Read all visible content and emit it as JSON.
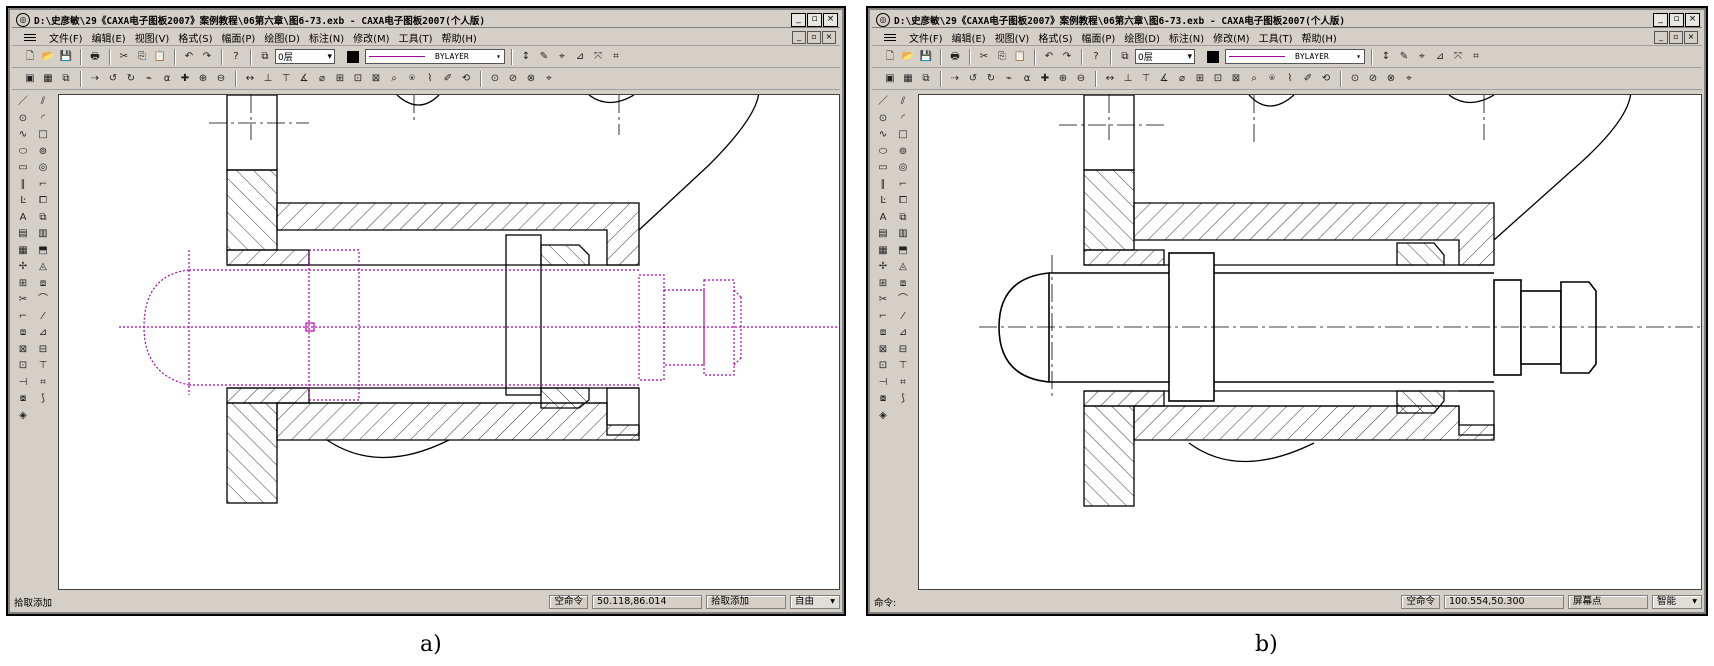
{
  "captions": {
    "a": "a)",
    "b": "b)"
  },
  "colors": {
    "preview_line": "#b000b0",
    "drawing_line": "#000000",
    "window_face": "#d4d0c8"
  },
  "window_a": {
    "title": "D:\\史彦敏\\29《CAXA电子图板2007》案例教程\\06第六章\\图6-73.exb - CAXA电子图板2007(个人版)",
    "menu": [
      "文件(F)",
      "编辑(E)",
      "视图(V)",
      "格式(S)",
      "幅面(P)",
      "绘图(D)",
      "标注(N)",
      "修改(M)",
      "工具(T)",
      "帮助(H)"
    ],
    "layer": "0层",
    "linetype": "BYLAYER",
    "status": {
      "prompt": "拾取添加",
      "command": "空命令",
      "coords": "50.118,86.014",
      "mode": "拾取添加",
      "snap": "自由"
    }
  },
  "window_b": {
    "title": "D:\\史彦敏\\29《CAXA电子图板2007》案例教程\\06第六章\\图6-73.exb - CAXA电子图板2007(个人版)",
    "menu": [
      "文件(F)",
      "编辑(E)",
      "视图(V)",
      "格式(S)",
      "幅面(P)",
      "绘图(D)",
      "标注(N)",
      "修改(M)",
      "工具(T)",
      "帮助(H)"
    ],
    "layer": "0层",
    "linetype": "BYLAYER",
    "status": {
      "prompt": "命令:",
      "command": "空命令",
      "coords": "100.554,50.300",
      "mode": "屏幕点",
      "snap": "智能"
    }
  },
  "icons": {
    "toolbar1": [
      "new-file-icon",
      "open-icon",
      "save-icon",
      "print-icon",
      "cut-icon",
      "copy-icon",
      "paste-icon",
      "undo-icon",
      "redo-icon",
      "help-icon"
    ],
    "toolbar1_glyphs": [
      "🗋",
      "📂",
      "💾",
      "🖶",
      "✂",
      "⎘",
      "📋",
      "↶",
      "↷",
      "?"
    ],
    "tools_right": [
      "↕",
      "✎",
      "⌖",
      "⊿",
      "⤧",
      "⌗"
    ],
    "toolbar2": [
      "▣",
      "▦",
      "⧉",
      "⇢",
      "↺",
      "↻",
      "⌁",
      "⍺",
      "✚",
      "⊕",
      "⊖",
      "↔",
      "⊥",
      "⊤",
      "∡",
      "⌀",
      "⊞",
      "⊡",
      "⊠",
      "⌕",
      "⍟",
      "⌇",
      "✐",
      "⟲",
      "⊙",
      "⊘",
      "⊗",
      "⌖"
    ],
    "left": [
      "／",
      "⫽",
      "⊙",
      "◜",
      "∿",
      "□",
      "⬭",
      "⊚",
      "▭",
      "◎",
      "∥",
      "⌐",
      "Ŀ",
      "⧠",
      "A",
      "⧉",
      "▤",
      "▥",
      "▦",
      "⬒",
      "✢",
      "◬",
      "⊞",
      "⧈",
      "✂",
      "⌒",
      "⌐",
      "⁄",
      "⧈",
      "⊿",
      "⊠",
      "⊟",
      "⊡",
      "⊤",
      "⊣",
      "⌗",
      "⧇",
      "⟆",
      "◈"
    ]
  }
}
